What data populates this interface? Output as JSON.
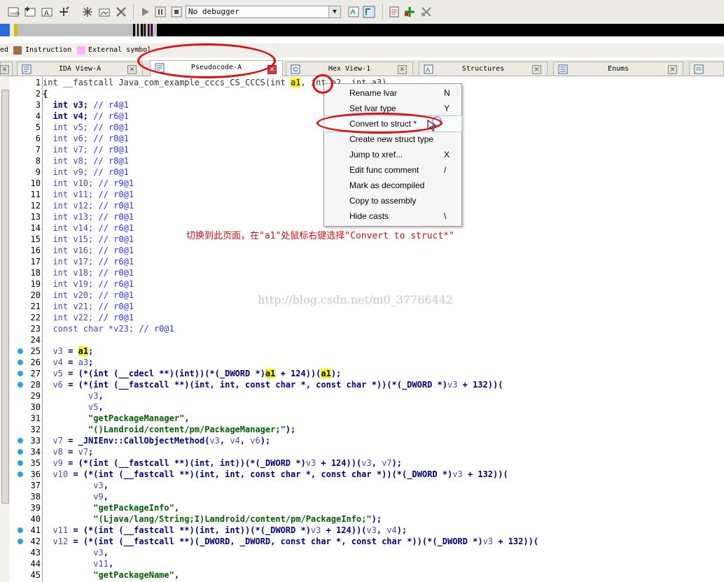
{
  "toolbar": {
    "icons": [
      "code-icon",
      "add-icon",
      "text-icon",
      "arrows-icon",
      "star-icon",
      "image-icon",
      "close-icon",
      "play-icon",
      "pause-icon",
      "stop-icon",
      "trace-icon",
      "attach-icon",
      "list-icon",
      "plus-icon",
      "remove-icon"
    ],
    "debugger_selected": "No debugger"
  },
  "legend": {
    "partial_label": "ed",
    "instruction_label": "Instruction",
    "external_label": "External symbol",
    "instruction_color": "#a0704c",
    "external_color": "#ffb3ff"
  },
  "tabs": [
    {
      "label": "IDA View-A"
    },
    {
      "label": "Pseudocode-A"
    },
    {
      "label": "Hex View-1"
    },
    {
      "label": "Structures"
    },
    {
      "label": "Enums"
    }
  ],
  "code": {
    "line_numbers": [
      "1",
      "2",
      "3",
      "4",
      "5",
      "6",
      "7",
      "8",
      "9",
      "10",
      "11",
      "12",
      "13",
      "14",
      "15",
      "16",
      "17",
      "18",
      "19",
      "20",
      "21",
      "22",
      "23",
      "24",
      "25",
      "26",
      "27",
      "28",
      "29",
      "30",
      "31",
      "32",
      "33",
      "34",
      "35",
      "36",
      "37",
      "38",
      "39",
      "40",
      "41",
      "42",
      "43",
      "44",
      "45"
    ],
    "breakpoints": [
      25,
      26,
      27,
      28,
      33,
      34,
      35,
      36,
      41,
      42
    ]
  },
  "context_menu": {
    "items": [
      {
        "label": "Rename lvar",
        "key": "N"
      },
      {
        "label": "Set lvar type",
        "key": "Y"
      },
      {
        "label": "Convert to struct *",
        "key": ""
      },
      {
        "label": "Create new struct type",
        "key": ""
      },
      {
        "label": "Jump to xref...",
        "key": "X"
      },
      {
        "label": "Edit func comment",
        "key": "/"
      },
      {
        "label": "Mark as decompiled",
        "key": ""
      },
      {
        "label": "Copy to assembly",
        "key": ""
      },
      {
        "label": "Hide casts",
        "key": "\\"
      }
    ]
  },
  "annotation_text": "切换到此页面，在\"a1\"处鼠标右键选择\"Convert to struct*\"",
  "watermark_text": "http://blog.csdn.net/m0_37766442",
  "colors": {
    "highlight": "#f7f700",
    "breakpoint": "#29a6d9",
    "annotation_red": "#e01010"
  }
}
